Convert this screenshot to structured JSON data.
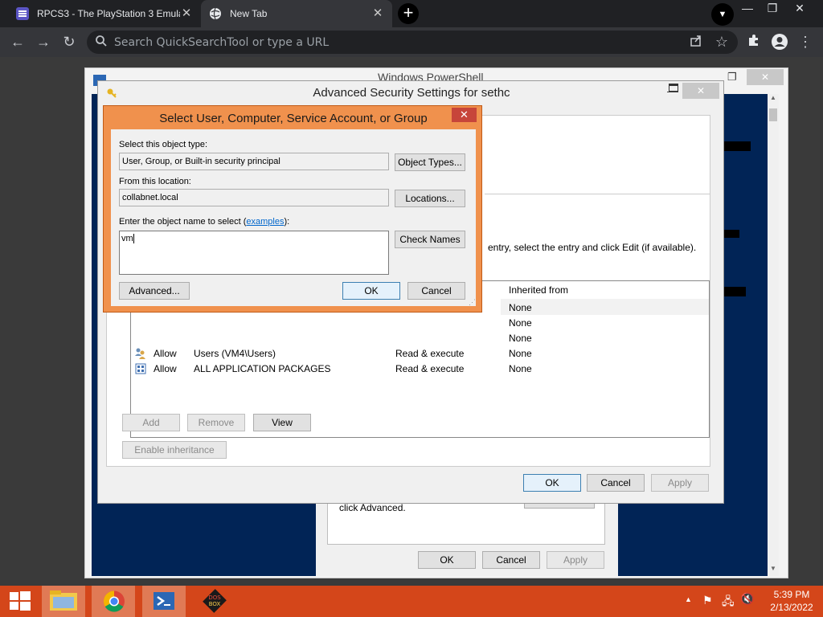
{
  "browser": {
    "tabs": [
      {
        "title": "RPCS3 - The PlayStation 3 Emula",
        "active": false,
        "close": "✕"
      },
      {
        "title": "New Tab",
        "active": true,
        "close": "✕"
      }
    ],
    "new_tab": "+",
    "omnibox_placeholder": "Search QuickSearchTool or type a URL",
    "icons": [
      "back-icon",
      "forward-icon",
      "reload-icon",
      "search-icon",
      "share-icon",
      "star-icon",
      "extensions-icon",
      "profile-icon",
      "menu-icon"
    ]
  },
  "powershell": {
    "title": "Windows PowerShell"
  },
  "advanced_dialog": {
    "title": "Advanced Security Settings for sethc",
    "hint": "entry, select the entry and click Edit (if available).",
    "columns": {
      "inherited_from": "Inherited from"
    },
    "rows": [
      {
        "type": "",
        "principal": "",
        "access": "",
        "inherited": "None"
      },
      {
        "type": "",
        "principal": "",
        "access": "",
        "inherited": "None"
      },
      {
        "type": "",
        "principal": "",
        "access": "",
        "inherited": "None"
      },
      {
        "type": "Allow",
        "principal": "Users (VM4\\Users)",
        "access": "Read & execute",
        "inherited": "None"
      },
      {
        "type": "Allow",
        "principal": "ALL APPLICATION PACKAGES",
        "access": "Read & execute",
        "inherited": "None"
      }
    ],
    "buttons": {
      "add": "Add",
      "remove": "Remove",
      "view": "View",
      "enable_inheritance": "Enable inheritance",
      "ok": "OK",
      "cancel": "Cancel",
      "apply": "Apply"
    }
  },
  "background_dialog": {
    "text": "click Advanced.",
    "buttons": {
      "ok": "OK",
      "cancel": "Cancel",
      "apply": "Apply"
    }
  },
  "select_dialog": {
    "title": "Select User, Computer, Service Account, or Group",
    "object_type_label": "Select this object type:",
    "object_type_value": "User, Group, or Built-in security principal",
    "object_types_button": "Object Types...",
    "location_label": "From this location:",
    "location_value": "collabnet.local",
    "locations_button": "Locations...",
    "name_label_prefix": "Enter the object name to select (",
    "name_label_link": "examples",
    "name_label_suffix": "):",
    "name_value": "vm",
    "check_names_button": "Check Names",
    "advanced_button": "Advanced...",
    "ok_button": "OK",
    "cancel_button": "Cancel",
    "close": "✕"
  },
  "taskbar": {
    "time": "5:39 PM",
    "date": "2/13/2022",
    "apps": [
      "file-explorer-icon",
      "chrome-icon",
      "powershell-icon",
      "dosbox-icon"
    ],
    "accent": "#d4461a"
  }
}
